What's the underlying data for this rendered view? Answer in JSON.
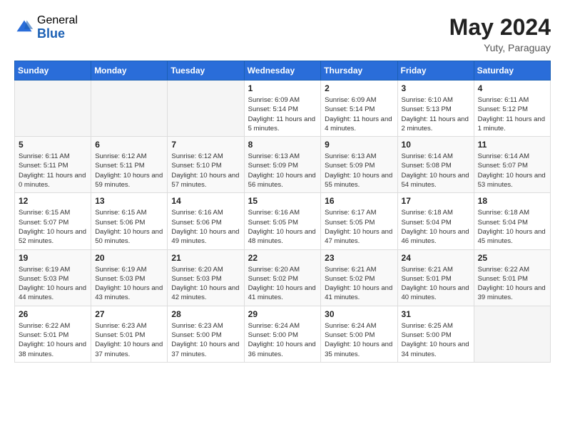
{
  "header": {
    "logo_general": "General",
    "logo_blue": "Blue",
    "month_year": "May 2024",
    "location": "Yuty, Paraguay"
  },
  "weekdays": [
    "Sunday",
    "Monday",
    "Tuesday",
    "Wednesday",
    "Thursday",
    "Friday",
    "Saturday"
  ],
  "weeks": [
    [
      {
        "day": "",
        "info": ""
      },
      {
        "day": "",
        "info": ""
      },
      {
        "day": "",
        "info": ""
      },
      {
        "day": "1",
        "info": "Sunrise: 6:09 AM\nSunset: 5:14 PM\nDaylight: 11 hours and 5 minutes."
      },
      {
        "day": "2",
        "info": "Sunrise: 6:09 AM\nSunset: 5:14 PM\nDaylight: 11 hours and 4 minutes."
      },
      {
        "day": "3",
        "info": "Sunrise: 6:10 AM\nSunset: 5:13 PM\nDaylight: 11 hours and 2 minutes."
      },
      {
        "day": "4",
        "info": "Sunrise: 6:11 AM\nSunset: 5:12 PM\nDaylight: 11 hours and 1 minute."
      }
    ],
    [
      {
        "day": "5",
        "info": "Sunrise: 6:11 AM\nSunset: 5:11 PM\nDaylight: 11 hours and 0 minutes."
      },
      {
        "day": "6",
        "info": "Sunrise: 6:12 AM\nSunset: 5:11 PM\nDaylight: 10 hours and 59 minutes."
      },
      {
        "day": "7",
        "info": "Sunrise: 6:12 AM\nSunset: 5:10 PM\nDaylight: 10 hours and 57 minutes."
      },
      {
        "day": "8",
        "info": "Sunrise: 6:13 AM\nSunset: 5:09 PM\nDaylight: 10 hours and 56 minutes."
      },
      {
        "day": "9",
        "info": "Sunrise: 6:13 AM\nSunset: 5:09 PM\nDaylight: 10 hours and 55 minutes."
      },
      {
        "day": "10",
        "info": "Sunrise: 6:14 AM\nSunset: 5:08 PM\nDaylight: 10 hours and 54 minutes."
      },
      {
        "day": "11",
        "info": "Sunrise: 6:14 AM\nSunset: 5:07 PM\nDaylight: 10 hours and 53 minutes."
      }
    ],
    [
      {
        "day": "12",
        "info": "Sunrise: 6:15 AM\nSunset: 5:07 PM\nDaylight: 10 hours and 52 minutes."
      },
      {
        "day": "13",
        "info": "Sunrise: 6:15 AM\nSunset: 5:06 PM\nDaylight: 10 hours and 50 minutes."
      },
      {
        "day": "14",
        "info": "Sunrise: 6:16 AM\nSunset: 5:06 PM\nDaylight: 10 hours and 49 minutes."
      },
      {
        "day": "15",
        "info": "Sunrise: 6:16 AM\nSunset: 5:05 PM\nDaylight: 10 hours and 48 minutes."
      },
      {
        "day": "16",
        "info": "Sunrise: 6:17 AM\nSunset: 5:05 PM\nDaylight: 10 hours and 47 minutes."
      },
      {
        "day": "17",
        "info": "Sunrise: 6:18 AM\nSunset: 5:04 PM\nDaylight: 10 hours and 46 minutes."
      },
      {
        "day": "18",
        "info": "Sunrise: 6:18 AM\nSunset: 5:04 PM\nDaylight: 10 hours and 45 minutes."
      }
    ],
    [
      {
        "day": "19",
        "info": "Sunrise: 6:19 AM\nSunset: 5:03 PM\nDaylight: 10 hours and 44 minutes."
      },
      {
        "day": "20",
        "info": "Sunrise: 6:19 AM\nSunset: 5:03 PM\nDaylight: 10 hours and 43 minutes."
      },
      {
        "day": "21",
        "info": "Sunrise: 6:20 AM\nSunset: 5:03 PM\nDaylight: 10 hours and 42 minutes."
      },
      {
        "day": "22",
        "info": "Sunrise: 6:20 AM\nSunset: 5:02 PM\nDaylight: 10 hours and 41 minutes."
      },
      {
        "day": "23",
        "info": "Sunrise: 6:21 AM\nSunset: 5:02 PM\nDaylight: 10 hours and 41 minutes."
      },
      {
        "day": "24",
        "info": "Sunrise: 6:21 AM\nSunset: 5:01 PM\nDaylight: 10 hours and 40 minutes."
      },
      {
        "day": "25",
        "info": "Sunrise: 6:22 AM\nSunset: 5:01 PM\nDaylight: 10 hours and 39 minutes."
      }
    ],
    [
      {
        "day": "26",
        "info": "Sunrise: 6:22 AM\nSunset: 5:01 PM\nDaylight: 10 hours and 38 minutes."
      },
      {
        "day": "27",
        "info": "Sunrise: 6:23 AM\nSunset: 5:01 PM\nDaylight: 10 hours and 37 minutes."
      },
      {
        "day": "28",
        "info": "Sunrise: 6:23 AM\nSunset: 5:00 PM\nDaylight: 10 hours and 37 minutes."
      },
      {
        "day": "29",
        "info": "Sunrise: 6:24 AM\nSunset: 5:00 PM\nDaylight: 10 hours and 36 minutes."
      },
      {
        "day": "30",
        "info": "Sunrise: 6:24 AM\nSunset: 5:00 PM\nDaylight: 10 hours and 35 minutes."
      },
      {
        "day": "31",
        "info": "Sunrise: 6:25 AM\nSunset: 5:00 PM\nDaylight: 10 hours and 34 minutes."
      },
      {
        "day": "",
        "info": ""
      }
    ]
  ]
}
